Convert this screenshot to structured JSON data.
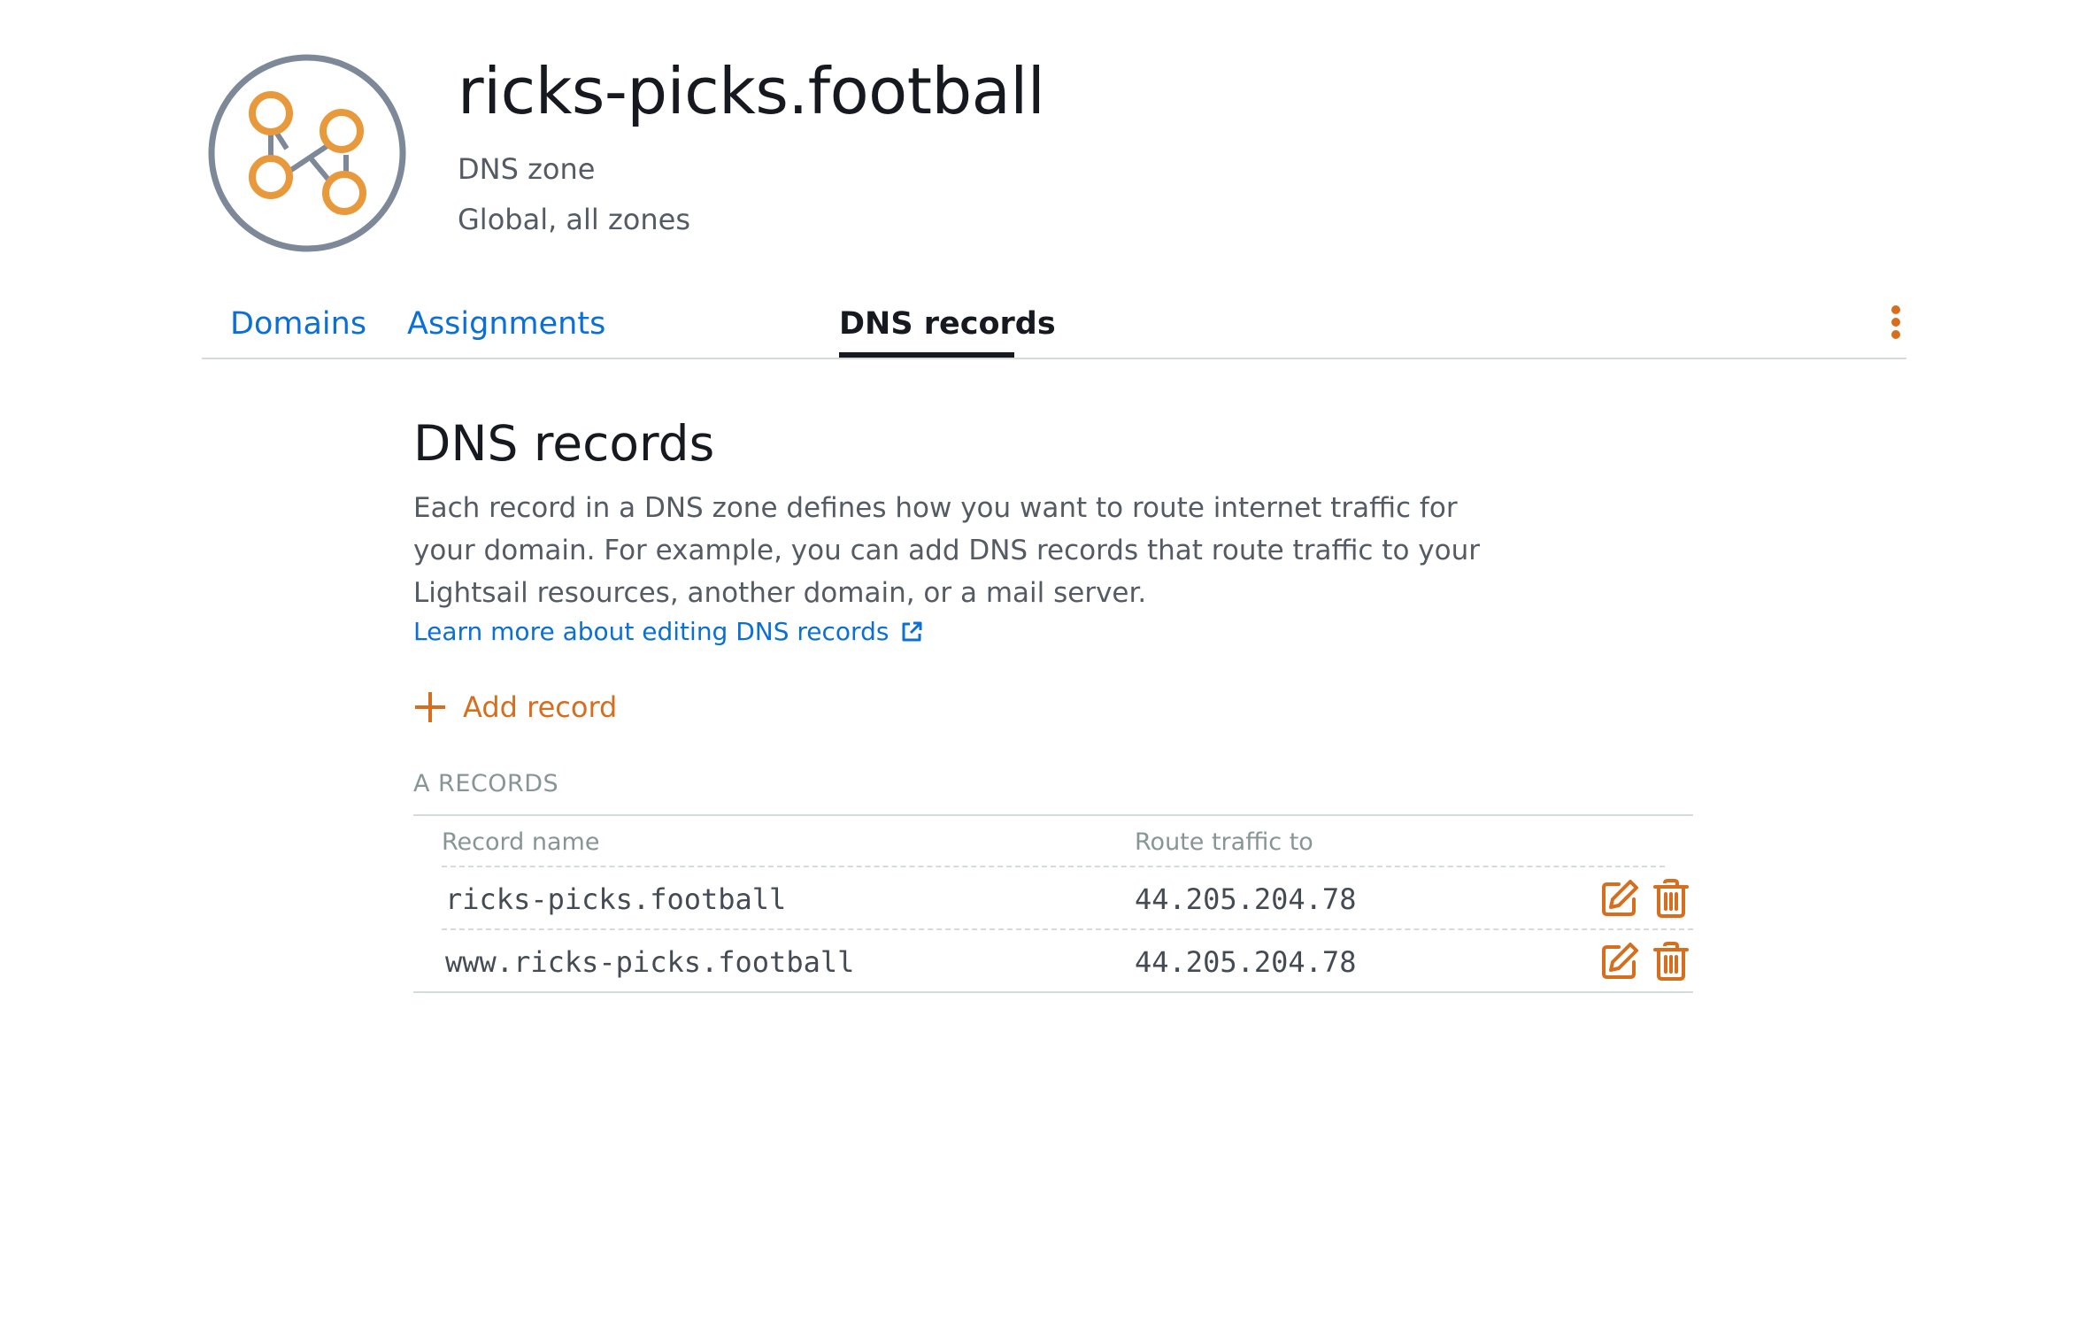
{
  "header": {
    "title": "ricks-picks.football",
    "type": "DNS zone",
    "region": "Global, all zones",
    "icon": "dns-zone-icon"
  },
  "tabs": [
    {
      "label": "Domains",
      "active": false
    },
    {
      "label": "Assignments",
      "active": false
    },
    {
      "label": "DNS records",
      "active": true
    }
  ],
  "section": {
    "title": "DNS records",
    "description": "Each record in a DNS zone defines how you want to route internet traffic for your domain. For example, you can add DNS records that route traffic to your Lightsail resources, another domain, or a mail server.",
    "learn_more": "Learn more about editing DNS records",
    "add_record": "Add record"
  },
  "a_records": {
    "group_label": "A RECORDS",
    "columns": [
      "Record name",
      "Route traffic to"
    ],
    "rows": [
      {
        "name": "ricks-picks.football",
        "route": "44.205.204.78"
      },
      {
        "name": "www.ricks-picks.football",
        "route": "44.205.204.78"
      }
    ]
  },
  "colors": {
    "accent": "#d66e1e",
    "link": "#0a6fd6",
    "text": "#16191f",
    "muted": "#545b64",
    "icon_gray": "#7d8998",
    "icon_orange": "#e8993c"
  }
}
